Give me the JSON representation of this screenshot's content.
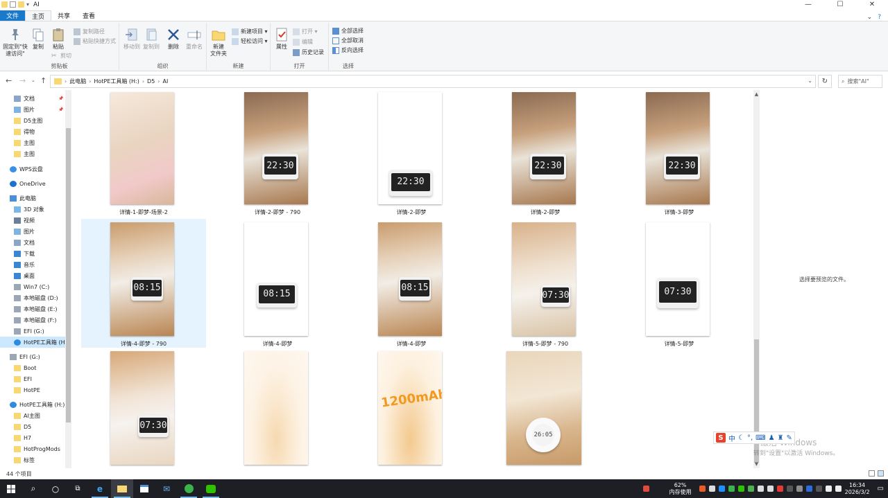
{
  "window": {
    "title": "AI",
    "controls": {
      "minimize": "—",
      "maximize": "☐",
      "close": "✕"
    }
  },
  "tabs": {
    "file": "文件",
    "home": "主页",
    "share": "共享",
    "view": "查看"
  },
  "ribbon": {
    "clipboard": {
      "label": "剪贴板",
      "pin": "固定到\"快\n速访问\"",
      "copy": "复制",
      "paste": "粘贴",
      "copy_path": "复制路径",
      "paste_shortcut": "粘贴快捷方式",
      "cut": "剪切"
    },
    "organize": {
      "label": "组织",
      "move_to": "移动到",
      "copy_to": "复制到",
      "delete": "删除",
      "rename": "重命名"
    },
    "new": {
      "label": "新建",
      "new_folder": "新建\n文件夹",
      "new_item": "新建项目 ▾",
      "easy_access": "轻松访问 ▾"
    },
    "open": {
      "label": "打开",
      "properties": "属性",
      "open": "打开 ▾",
      "edit": "编辑",
      "history": "历史记录"
    },
    "select": {
      "label": "选择",
      "select_all": "全部选择",
      "select_none": "全部取消",
      "invert": "反向选择"
    }
  },
  "address": {
    "crumbs": [
      "此电脑",
      "HotPE工具箱 (H:)",
      "D5",
      "AI"
    ],
    "search_placeholder": "搜索\"AI\""
  },
  "nav": [
    {
      "label": "文档",
      "icon": "documents-icon",
      "pinned": true
    },
    {
      "label": "图片",
      "icon": "pictures-icon",
      "pinned": true
    },
    {
      "label": "D5主图",
      "icon": "folder-icon"
    },
    {
      "label": "得物",
      "icon": "folder-icon"
    },
    {
      "label": "主图",
      "icon": "folder-icon"
    },
    {
      "label": "主图",
      "icon": "folder-icon"
    },
    {
      "label": "WPS云盘",
      "icon": "wps-cloud-icon"
    },
    {
      "label": "OneDrive",
      "icon": "onedrive-icon"
    },
    {
      "label": "此电脑",
      "icon": "this-pc-icon"
    },
    {
      "label": "3D 对象",
      "icon": "3d-objects-icon"
    },
    {
      "label": "视频",
      "icon": "videos-icon"
    },
    {
      "label": "图片",
      "icon": "pictures-icon"
    },
    {
      "label": "文档",
      "icon": "documents-icon"
    },
    {
      "label": "下载",
      "icon": "downloads-icon"
    },
    {
      "label": "音乐",
      "icon": "music-icon"
    },
    {
      "label": "桌面",
      "icon": "desktop-icon"
    },
    {
      "label": "Win7 (C:)",
      "icon": "drive-icon"
    },
    {
      "label": "本地磁盘 (D:)",
      "icon": "drive-icon"
    },
    {
      "label": "本地磁盘 (E:)",
      "icon": "drive-icon"
    },
    {
      "label": "本地磁盘 (F:)",
      "icon": "drive-icon"
    },
    {
      "label": "EFI (G:)",
      "icon": "drive-icon"
    },
    {
      "label": "HotPE工具箱 (H",
      "icon": "hotpe-drive-icon",
      "selected": true
    },
    {
      "label": "EFI (G:)",
      "icon": "drive-icon"
    },
    {
      "label": "Boot",
      "icon": "folder-icon"
    },
    {
      "label": "EFI",
      "icon": "folder-icon"
    },
    {
      "label": "HotPE",
      "icon": "folder-icon"
    },
    {
      "label": "HotPE工具箱 (H:)",
      "icon": "hotpe-drive-icon"
    },
    {
      "label": "AI主图",
      "icon": "folder-icon"
    },
    {
      "label": "D5",
      "icon": "folder-icon"
    },
    {
      "label": "H7",
      "icon": "folder-icon"
    },
    {
      "label": "HotProgMods",
      "icon": "folder-icon"
    },
    {
      "label": "标签",
      "icon": "folder-icon"
    }
  ],
  "files": [
    {
      "name": "详情-1-即梦-场景-2",
      "clock": ""
    },
    {
      "name": "详情-2-即梦 - 790",
      "clock": "22:30"
    },
    {
      "name": "详情-2-即梦",
      "clock": "22:30"
    },
    {
      "name": "详情-2-即梦",
      "clock": "22:30"
    },
    {
      "name": "详情-3-即梦",
      "clock": "22:30"
    },
    {
      "name": "详情-4-即梦 - 790",
      "clock": "08:15",
      "selected": true
    },
    {
      "name": "详情-4-即梦",
      "clock": "08:15"
    },
    {
      "name": "详情-4-即梦",
      "clock": "08:15"
    },
    {
      "name": "详情-5-即梦 - 790",
      "clock": "07:30"
    },
    {
      "name": "详情-5-即梦",
      "clock": "07:30"
    },
    {
      "name": "",
      "clock": "07:30"
    },
    {
      "name": "",
      "clock": ""
    },
    {
      "name": "",
      "clock": "",
      "overlay": "1200mAh"
    },
    {
      "name": "",
      "clock": "26:05"
    }
  ],
  "preview_text": "选择要预览的文件。",
  "status": {
    "count": "44 个项目"
  },
  "watermark": {
    "line1": "激活 Windows",
    "line2": "转到\"设置\"以激活 Windows。"
  },
  "ime": {
    "label": "中"
  },
  "taskbar": {
    "cpu_percent": "62%",
    "cpu_label": "内存使用",
    "time": "16:34",
    "date": "2026/3/2"
  }
}
